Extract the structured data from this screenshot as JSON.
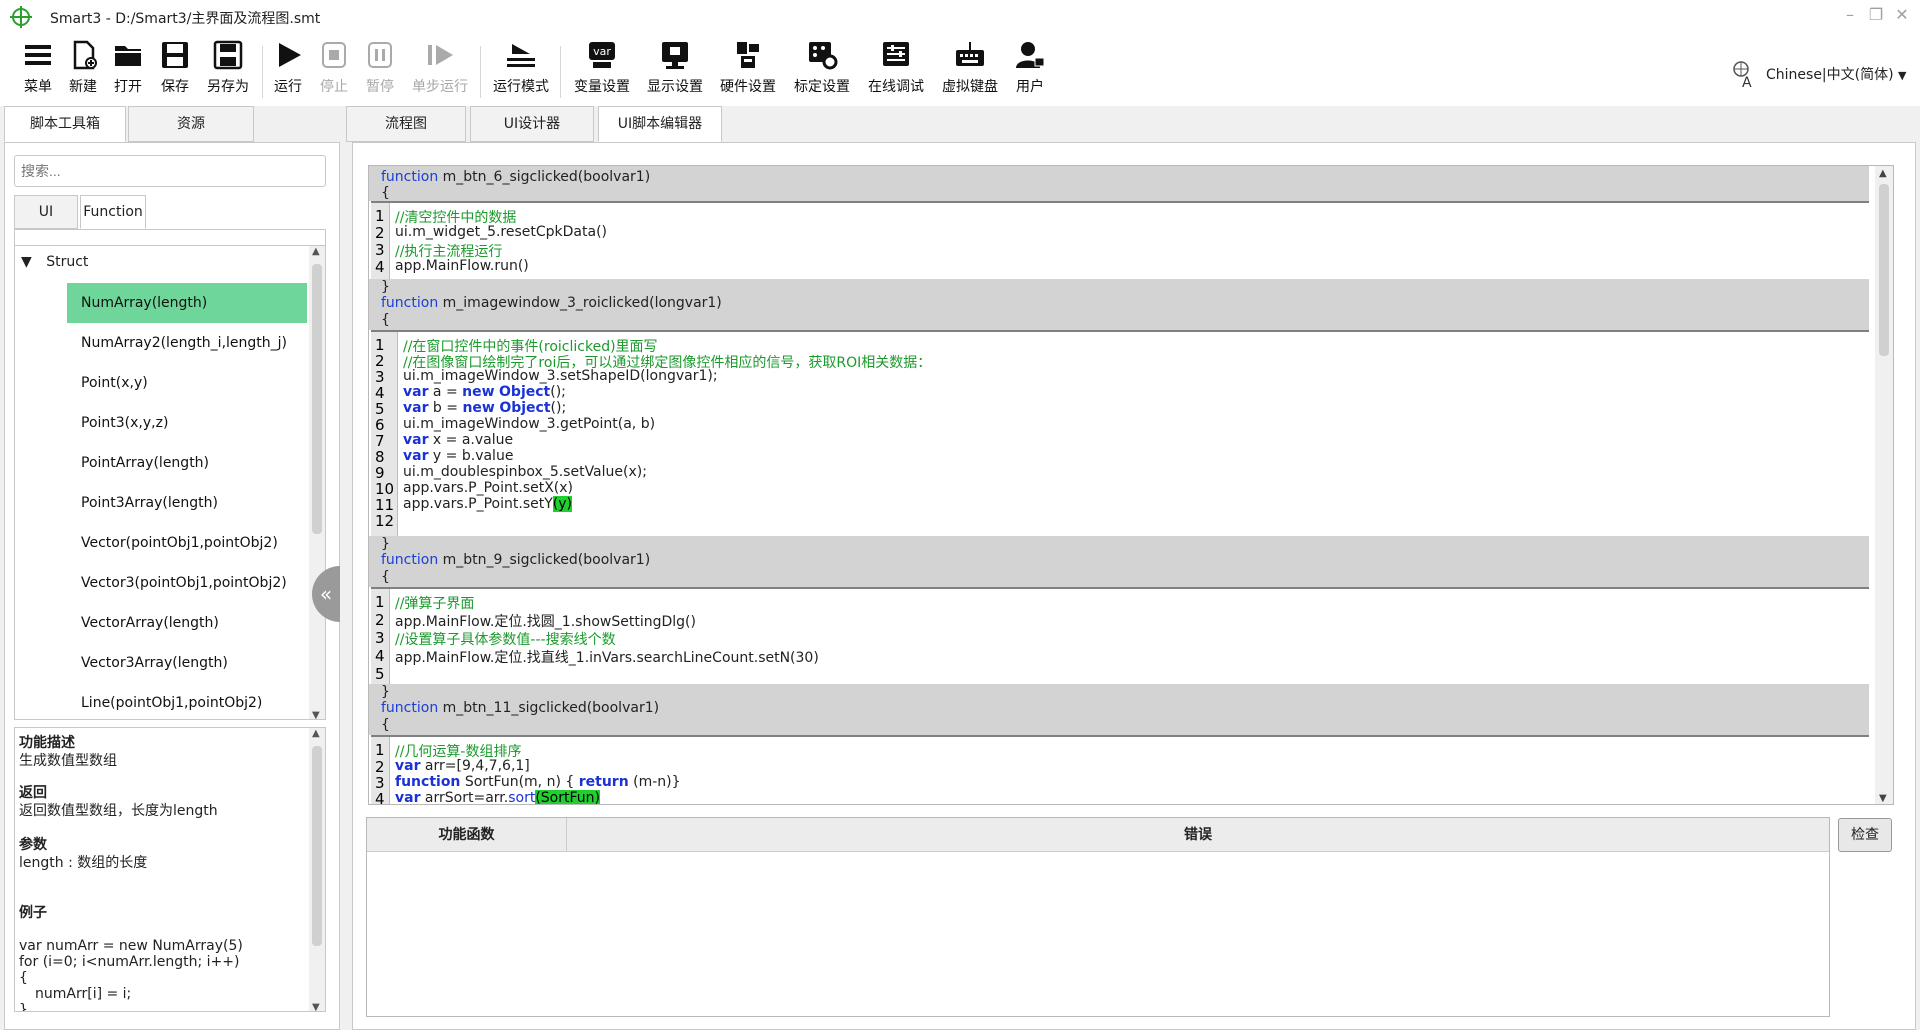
{
  "window": {
    "title": "Smart3 - D:/Smart3/主界面及流程图.smt"
  },
  "toolbar": {
    "items": [
      {
        "label": "菜单",
        "icon": "menu-icon",
        "enabled": true
      },
      {
        "label": "新建",
        "icon": "new-file-icon",
        "enabled": true
      },
      {
        "label": "打开",
        "icon": "folder-icon",
        "enabled": true
      },
      {
        "label": "保存",
        "icon": "save-icon",
        "enabled": true
      },
      {
        "label": "另存为",
        "icon": "save-as-icon",
        "enabled": true
      },
      {
        "label": "运行",
        "icon": "play-icon",
        "enabled": true
      },
      {
        "label": "停止",
        "icon": "stop-icon",
        "enabled": false
      },
      {
        "label": "暂停",
        "icon": "pause-icon",
        "enabled": false
      },
      {
        "label": "单步运行",
        "icon": "step-icon",
        "enabled": false
      },
      {
        "label": "运行模式",
        "icon": "run-mode-icon",
        "enabled": true
      },
      {
        "label": "变量设置",
        "icon": "var-icon",
        "enabled": true
      },
      {
        "label": "显示设置",
        "icon": "display-icon",
        "enabled": true
      },
      {
        "label": "硬件设置",
        "icon": "hardware-icon",
        "enabled": true
      },
      {
        "label": "标定设置",
        "icon": "calibration-icon",
        "enabled": true
      },
      {
        "label": "在线调试",
        "icon": "debug-icon",
        "enabled": true
      },
      {
        "label": "虚拟键盘",
        "icon": "keyboard-icon",
        "enabled": true
      },
      {
        "label": "用户",
        "icon": "user-icon",
        "enabled": true
      }
    ],
    "language": "Chinese|中文(简体)"
  },
  "left": {
    "tabs": [
      "脚本工具箱",
      "资源"
    ],
    "search_placeholder": "搜索...",
    "subtabs": [
      "UI",
      "Function"
    ],
    "tree_group": "Struct",
    "items": [
      "NumArray(length)",
      "NumArray2(length_i,length_j)",
      "Point(x,y)",
      "Point3(x,y,z)",
      "PointArray(length)",
      "Point3Array(length)",
      "Vector(pointObj1,pointObj2)",
      "Vector3(pointObj1,pointObj2)",
      "VectorArray(length)",
      "Vector3Array(length)",
      "Line(pointObj1,pointObj2)"
    ],
    "desc": {
      "h1": "功能描述",
      "t1": "生成数值型数组",
      "h2": "返回",
      "t2": "返回数值型数组，长度为length",
      "h3": "参数",
      "t3": "length : 数组的长度",
      "h4": "例子",
      "ex1": "var numArr = new NumArray(5)",
      "ex2": "for (i=0; i<numArr.length; i++)",
      "ex3": "{",
      "ex4": "numArr[i] = i;",
      "ex5": "}"
    }
  },
  "editor_tabs": [
    "流程图",
    "UI设计器",
    "UI脚本编辑器"
  ],
  "code": {
    "f1": {
      "kw": "function",
      "name": " m_btn_6_sigclicked(boolvar1)",
      "open": "{",
      "close": "}",
      "l1": "//清空控件中的数据",
      "l2": "ui.m_widget_5.resetCpkData()",
      "l3": "//执行主流程运行",
      "l4": "app.MainFlow.run()"
    },
    "f2": {
      "kw": "function",
      "name": " m_imagewindow_3_roiclicked(longvar1)",
      "open": "{",
      "close": "}",
      "l1": "//在窗口控件中的事件(roiclicked)里面写",
      "l2": "//在图像窗口绘制完了roi后，可以通过绑定图像控件相应的信号，获取ROI相关数据：",
      "l3": "ui.m_imageWindow_3.setShapeID(longvar1);",
      "l4a": "var",
      "l4b": " a = ",
      "l4c": "new",
      "l4d": " ",
      "l4e": "Object",
      "l4f": "();",
      "l5a": "var",
      "l5b": " b = ",
      "l5c": "new",
      "l5d": " ",
      "l5e": "Object",
      "l5f": "();",
      "l6": "ui.m_imageWindow_3.getPoint(a, b)",
      "l7a": "var",
      "l7b": " x = a.value",
      "l8a": "var",
      "l8b": " y = b.value",
      "l9": "ui.m_doublespinbox_5.setValue(x);",
      "l10": "app.vars.P_Point.setX(x)",
      "l11a": "app.vars.P_Point.setY",
      "l11b": "(y)"
    },
    "f3": {
      "kw": "function",
      "name": " m_btn_9_sigclicked(boolvar1)",
      "open": "{",
      "close": "}",
      "l1": "//弹算子界面",
      "l2": "app.MainFlow.定位.找圆_1.showSettingDlg()",
      "l3": "//设置算子具体参数值---搜索线个数",
      "l4": "app.MainFlow.定位.找直线_1.inVars.searchLineCount.setN(30)"
    },
    "f4": {
      "kw": "function",
      "name": " m_btn_11_sigclicked(boolvar1)",
      "open": "{",
      "l1": "//几何运算-数组排序",
      "l2a": "var",
      "l2b": " arr=[9,4,7,6,1]",
      "l3a": "function",
      "l3b": "  SortFun(m, n) { ",
      "l3c": "return",
      "l3d": " (m-n)}",
      "l4a": "var",
      "l4b": " arrSort=arr.",
      "l4c": "sort",
      "l4d": "(SortFun",
      "l4e": ")"
    }
  },
  "error_table": {
    "col1": "功能函数",
    "col2": "错误"
  },
  "check_button": "检查"
}
